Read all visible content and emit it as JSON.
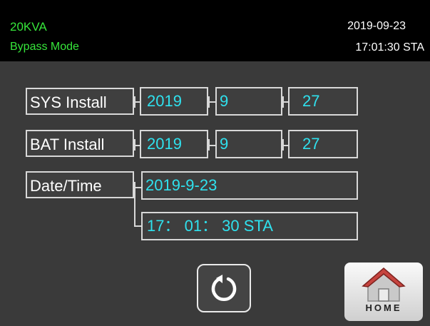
{
  "header": {
    "model": "20KVA",
    "mode": "Bypass Mode",
    "date": "2019-09-23",
    "time": "17:01:30 STA"
  },
  "sys_install": {
    "label": "SYS Install",
    "year": "2019",
    "month": "9",
    "day": "27"
  },
  "bat_install": {
    "label": "BAT Install",
    "year": "2019",
    "month": "9",
    "day": "27"
  },
  "date_time": {
    "label": "Date/Time",
    "date": "2019-9-23",
    "time": "17： 01： 30 STA"
  },
  "buttons": {
    "home_label": "HOME",
    "refresh_icon": "refresh-icon",
    "home_icon": "house-icon"
  },
  "colors": {
    "status_text": "#36e63a",
    "value_text": "#2fe1ee",
    "panel_bg": "#3a3a3a"
  }
}
